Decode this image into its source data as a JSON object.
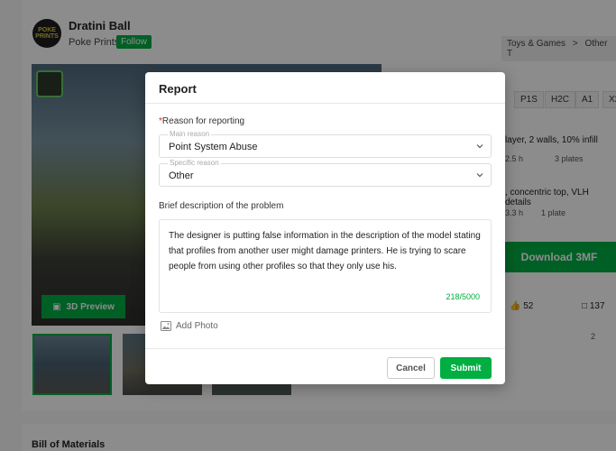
{
  "background": {
    "logo_text": "POKE PRINTS",
    "product_title": "Dratini Ball",
    "brand": "Poke Prints",
    "follow_label": "Follow",
    "breadcrumb": [
      "Toys & Games",
      ">",
      "Other T"
    ],
    "preview_label": "3D Preview",
    "chips": [
      "P1S",
      "H2C",
      "A1",
      "X2"
    ],
    "profile1": {
      "desc": "layer, 2 walls, 10% infill",
      "time": "2.5 h",
      "plates": "3 plates"
    },
    "profile2": {
      "desc": ", concentric top, VLH details",
      "time": "3.3 h",
      "plates": "1 plate"
    },
    "download_label": "Download 3MF",
    "likes": "52",
    "collects": "137",
    "comments": "2",
    "bom_title": "Bill of Materials"
  },
  "modal": {
    "title": "Report",
    "reason_label": "Reason for reporting",
    "required_mark": "*",
    "main_reason": {
      "floating_label": "Main reason",
      "value": "Point System Abuse"
    },
    "specific_reason": {
      "floating_label": "Specific reason",
      "value": "Other"
    },
    "description_label": "Brief description of the problem",
    "description_text": "The designer is putting false information in the description of the model stating that profiles from another user might damage printers. He is trying to scare people from using other profiles so that they only use his.",
    "char_count": "218/5000",
    "add_photo_label": "Add Photo",
    "cancel_label": "Cancel",
    "submit_label": "Submit"
  },
  "colors": {
    "accent": "#00ae42",
    "required": "#e02020"
  }
}
